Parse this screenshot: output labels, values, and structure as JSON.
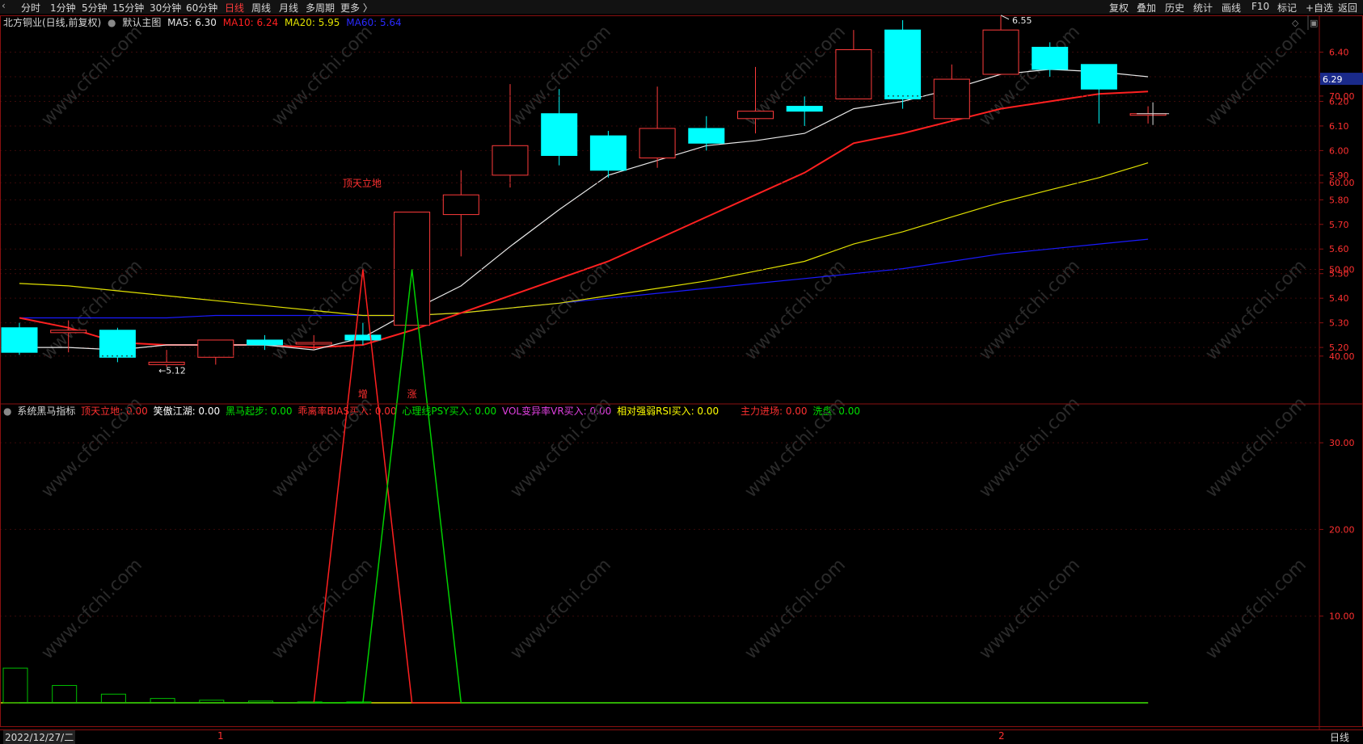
{
  "toolbar": {
    "left_items": [
      "分时",
      "1分钟",
      "5分钟",
      "15分钟",
      "30分钟",
      "60分钟",
      "日线",
      "周线",
      "月线",
      "多周期",
      "更多 〉"
    ],
    "active_index": 6,
    "right_items": [
      "复权",
      "叠加",
      "历史",
      "统计",
      "画线",
      "F10",
      "标记",
      "+自选",
      "返回"
    ]
  },
  "main_chart": {
    "stock_label": "北方铜业(日线,前复权)",
    "template_label": "默认主图",
    "ma5_label": "MA5: 6.30",
    "ma10_label": "MA10: 6.24",
    "ma20_label": "MA20: 5.95",
    "ma60_label": "MA60: 5.64",
    "price_ticks": [
      "6.40",
      "6.30",
      "6.20",
      "6.10",
      "6.00",
      "5.90",
      "5.80",
      "5.70",
      "5.60",
      "5.50",
      "5.40",
      "5.30",
      "5.20"
    ],
    "current_price": "6.29",
    "high_marker": "6.55",
    "low_marker": "5.12",
    "signal_labels": [
      "增",
      "涨"
    ]
  },
  "indicator": {
    "name": "系统黑马指标",
    "items": [
      {
        "text": "顶天立地: 0.00",
        "color": "#ff3030"
      },
      {
        "text": "笑傲江湖: 0.00",
        "color": "#ffffff"
      },
      {
        "text": "黑马起步: 0.00",
        "color": "#00e000"
      },
      {
        "text": "乖离率BIAS买入: 0.00",
        "color": "#ff3030"
      },
      {
        "text": "心理线PSY买入: 0.00",
        "color": "#00e000"
      },
      {
        "text": "VOL变异率VR买入: 0.00",
        "color": "#e040e0"
      },
      {
        "text": "相对强弱RSI买入: 0.00",
        "color": "#ffff00"
      },
      {
        "text": "主力进场: 0.00",
        "color": "#ff3030"
      },
      {
        "text": "洗盘: 0.00",
        "color": "#00e000"
      }
    ],
    "chart_label": "顶天立地",
    "y_ticks": [
      "70.00",
      "60.00",
      "50.00",
      "40.00",
      "30.00",
      "20.00",
      "10.00"
    ]
  },
  "bottom": {
    "date_label": "2022/12/27/二",
    "month_marks": [
      "1",
      "2"
    ],
    "period_label": "日线"
  },
  "watermark": "www.cfchi.com",
  "chart_data": {
    "type": "candlestick",
    "y_range": [
      5.15,
      6.55
    ],
    "candles": [
      {
        "o": 5.28,
        "c": 5.18,
        "h": 5.3,
        "l": 5.17
      },
      {
        "o": 5.26,
        "c": 5.27,
        "h": 5.31,
        "l": 5.18
      },
      {
        "o": 5.27,
        "c": 5.16,
        "h": 5.28,
        "l": 5.14
      },
      {
        "o": 5.13,
        "c": 5.14,
        "h": 5.19,
        "l": 5.12
      },
      {
        "o": 5.16,
        "c": 5.23,
        "h": 5.23,
        "l": 5.13
      },
      {
        "o": 5.23,
        "c": 5.21,
        "h": 5.25,
        "l": 5.19
      },
      {
        "o": 5.22,
        "c": 5.22,
        "h": 5.25,
        "l": 5.19
      },
      {
        "o": 5.25,
        "c": 5.23,
        "h": 5.3,
        "l": 5.21
      },
      {
        "o": 5.29,
        "c": 5.75,
        "h": 5.75,
        "l": 5.29
      },
      {
        "o": 5.74,
        "c": 5.82,
        "h": 5.92,
        "l": 5.57
      },
      {
        "o": 5.9,
        "c": 6.02,
        "h": 6.27,
        "l": 5.85
      },
      {
        "o": 6.15,
        "c": 5.98,
        "h": 6.25,
        "l": 5.94
      },
      {
        "o": 6.06,
        "c": 5.92,
        "h": 6.08,
        "l": 5.89
      },
      {
        "o": 5.97,
        "c": 6.09,
        "h": 6.26,
        "l": 5.93
      },
      {
        "o": 6.09,
        "c": 6.03,
        "h": 6.14,
        "l": 6.0
      },
      {
        "o": 6.13,
        "c": 6.16,
        "h": 6.34,
        "l": 6.07
      },
      {
        "o": 6.18,
        "c": 6.16,
        "h": 6.22,
        "l": 6.1
      },
      {
        "o": 6.21,
        "c": 6.41,
        "h": 6.49,
        "l": 6.21
      },
      {
        "o": 6.49,
        "c": 6.21,
        "h": 6.53,
        "l": 6.17
      },
      {
        "o": 6.13,
        "c": 6.29,
        "h": 6.35,
        "l": 6.12
      },
      {
        "o": 6.31,
        "c": 6.49,
        "h": 6.55,
        "l": 6.31
      },
      {
        "o": 6.42,
        "c": 6.33,
        "h": 6.44,
        "l": 6.3
      },
      {
        "o": 6.35,
        "c": 6.25,
        "h": 6.35,
        "l": 6.11
      },
      {
        "o": 6.15,
        "c": 6.15,
        "h": 6.18,
        "l": 6.11
      }
    ],
    "ma5": [
      5.2,
      5.2,
      5.19,
      5.21,
      5.21,
      5.21,
      5.19,
      5.24,
      5.35,
      5.45,
      5.61,
      5.76,
      5.9,
      5.96,
      6.02,
      6.04,
      6.07,
      6.17,
      6.2,
      6.25,
      6.31,
      6.33,
      6.32,
      6.3
    ],
    "ma10": [
      5.32,
      5.28,
      5.22,
      5.21,
      5.21,
      5.21,
      5.2,
      5.21,
      5.27,
      5.34,
      5.41,
      5.48,
      5.55,
      5.64,
      5.73,
      5.82,
      5.91,
      6.03,
      6.07,
      6.12,
      6.17,
      6.2,
      6.23,
      6.24
    ],
    "ma20": [
      5.46,
      5.45,
      5.43,
      5.41,
      5.39,
      5.37,
      5.35,
      5.33,
      5.33,
      5.34,
      5.36,
      5.38,
      5.41,
      5.44,
      5.47,
      5.51,
      5.55,
      5.62,
      5.67,
      5.73,
      5.79,
      5.84,
      5.89,
      5.95
    ],
    "ma60": [
      5.32,
      5.32,
      5.32,
      5.32,
      5.33,
      5.33,
      5.33,
      5.33,
      5.33,
      5.34,
      5.36,
      5.38,
      5.4,
      5.42,
      5.44,
      5.46,
      5.48,
      5.5,
      5.52,
      5.55,
      5.58,
      5.6,
      5.62,
      5.64
    ],
    "indicator_y_range": [
      0,
      70
    ],
    "dingtian_series": [
      0,
      0,
      0,
      0,
      0,
      0,
      0,
      50,
      0,
      0,
      0,
      0,
      0,
      0,
      0,
      0,
      0,
      0,
      0,
      0,
      0,
      0,
      0,
      0
    ],
    "xiaoao_series": [
      0,
      0,
      0,
      0,
      0,
      0,
      0,
      0,
      50,
      0,
      0,
      0,
      0,
      0,
      0,
      0,
      0,
      0,
      0,
      0,
      0,
      0,
      0,
      0
    ],
    "bar_series": [
      4,
      2,
      1,
      0.5,
      0.3,
      0.2,
      0.1,
      0.1,
      0,
      0,
      0,
      0,
      0,
      0,
      0,
      0,
      0,
      0,
      0,
      0,
      0,
      0,
      0,
      0
    ]
  },
  "colors": {
    "up": "#ff3b3b",
    "down": "#00ffff",
    "ma5": "#e8e8e8",
    "ma10": "#ff2020",
    "ma20": "#e0e000",
    "ma60": "#1a1aff",
    "axis": "#8a1010"
  }
}
